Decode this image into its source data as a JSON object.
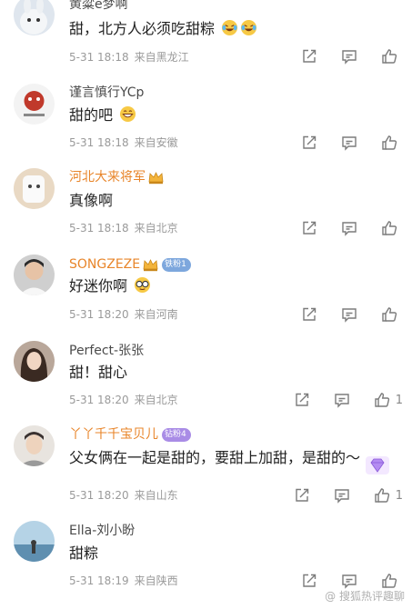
{
  "comments": [
    {
      "user": "黄粱e梦啊",
      "text": "甜，北方人必须吃甜粽",
      "time": "5-31 18:18",
      "location": "来自黑龙江",
      "likes": ""
    },
    {
      "user": "谨言慎行YCp",
      "text": "甜的吧",
      "time": "5-31 18:18",
      "location": "来自安徽",
      "likes": ""
    },
    {
      "user": "河北大来将军",
      "text": "真像啊",
      "time": "5-31 18:18",
      "location": "来自北京",
      "likes": ""
    },
    {
      "user": "SONGZEZE",
      "badge": "铁粉1",
      "text": "好迷你啊",
      "time": "5-31 18:20",
      "location": "来自河南",
      "likes": ""
    },
    {
      "user": "Perfect-张张",
      "text": "甜！甜心",
      "time": "5-31 18:20",
      "location": "来自北京",
      "likes": "1"
    },
    {
      "user": "丫丫千千宝贝儿",
      "badge": "钻粉4",
      "text": "父女俩在一起是甜的，要甜上加甜，是甜的～",
      "time": "5-31 18:20",
      "location": "来自山东",
      "likes": "1"
    },
    {
      "user": "Ella-刘小盼",
      "text": "甜粽",
      "time": "5-31 18:19",
      "location": "来自陕西",
      "likes": ""
    }
  ],
  "watermark": "@ 搜狐热评趣聊",
  "icons": [
    "share-icon",
    "comment-icon",
    "like-icon",
    "crown-icon",
    "laugh-cry-emoji",
    "grin-emoji",
    "sunglasses-emoji",
    "diamond-icon"
  ],
  "colors": {
    "orange_name": "#e8852a",
    "plain_name": "#4a4a4a",
    "meta": "#9a9a9a",
    "badge_blue": "#7da7dd",
    "badge_purple": "#a98ce6"
  }
}
